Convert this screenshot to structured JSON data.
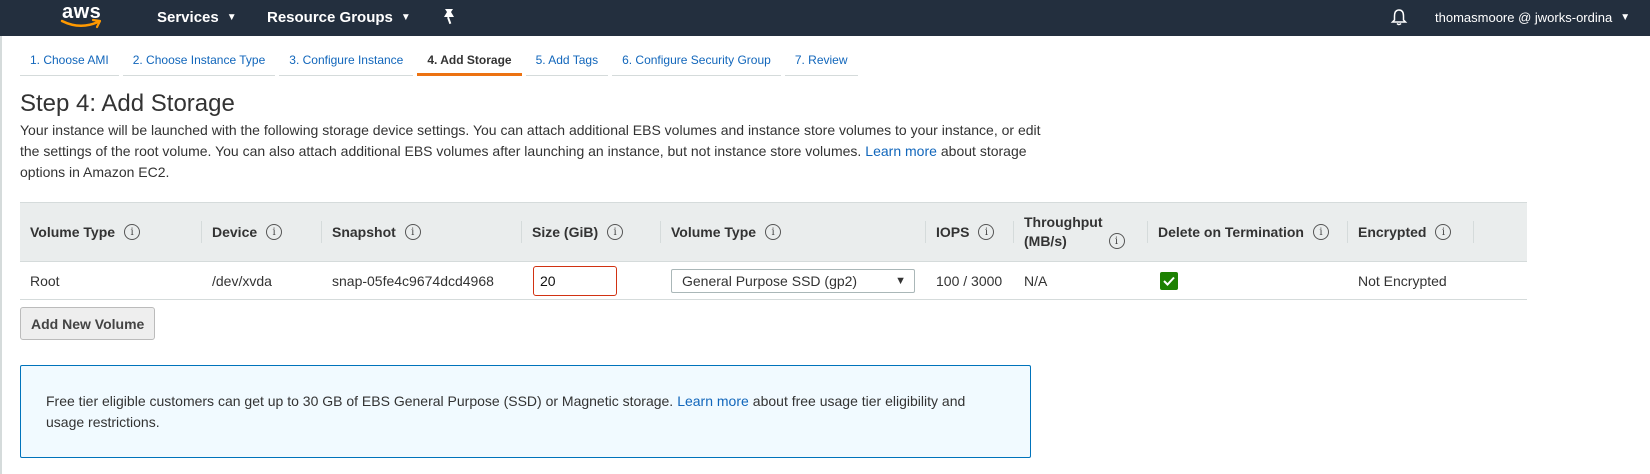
{
  "topnav": {
    "logo_text": "aws",
    "services_label": "Services",
    "resource_groups_label": "Resource Groups",
    "account_label": "thomasmoore @ jworks-ordina",
    "bg_color": "#232f3e"
  },
  "wizard": {
    "tabs": [
      {
        "label": "1. Choose AMI"
      },
      {
        "label": "2. Choose Instance Type"
      },
      {
        "label": "3. Configure Instance"
      },
      {
        "label": "4. Add Storage",
        "active": true
      },
      {
        "label": "5. Add Tags"
      },
      {
        "label": "6. Configure Security Group"
      },
      {
        "label": "7. Review"
      }
    ]
  },
  "page": {
    "title": "Step 4: Add Storage",
    "description_before": "Your instance will be launched with the following storage device settings. You can attach additional EBS volumes and instance store volumes to your instance, or edit the settings of the root volume. You can also attach additional EBS volumes after launching an instance, but not instance store volumes.",
    "learn_more": "Learn more",
    "description_after": "about storage options in Amazon EC2."
  },
  "table": {
    "headers": {
      "volume_type": "Volume Type",
      "device": "Device",
      "snapshot": "Snapshot",
      "size": "Size (GiB)",
      "volume_type2": "Volume Type",
      "iops": "IOPS",
      "throughput_line1": "Throughput",
      "throughput_line2": "(MB/s)",
      "delete_on_termination": "Delete on Termination",
      "encrypted": "Encrypted"
    },
    "row": {
      "volume_type": "Root",
      "device": "/dev/xvda",
      "snapshot": "snap-05fe4c9674dcd4968",
      "size": "20",
      "volume_type_select": "General Purpose SSD (gp2)",
      "iops": "100 / 3000",
      "throughput": "N/A",
      "delete_on_termination": true,
      "encrypted": "Not Encrypted"
    }
  },
  "actions": {
    "add_volume_label": "Add New Volume"
  },
  "info_box": {
    "text_before": "Free tier eligible customers can get up to 30 GB of EBS General Purpose (SSD) or Magnetic storage.",
    "learn_more": "Learn more",
    "text_after": "about free usage tier eligibility and usage restrictions."
  },
  "colors": {
    "accent": "#ec7211",
    "link": "#1166bb",
    "error_border": "#d13212",
    "checkbox": "#1d8102",
    "info_border": "#0073bb",
    "info_bg": "#f1faff"
  },
  "icons": {
    "nav_chevron": "chevron-down-icon",
    "pin": "pin-icon",
    "bell": "bell-icon",
    "info": "info-icon",
    "check": "check-icon"
  }
}
